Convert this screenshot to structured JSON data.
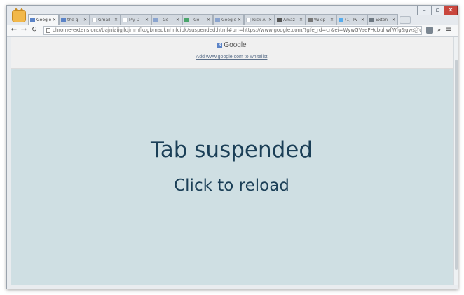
{
  "browser": {
    "tabs": [
      {
        "label": "Google",
        "favicon": "google-favicon",
        "color": "#5b83c7",
        "active": true
      },
      {
        "label": "the g",
        "favicon": "google-favicon",
        "color": "#5b83c7",
        "active": false
      },
      {
        "label": "Gmail",
        "favicon": "page-favicon",
        "color": "#bfc5cc",
        "active": false
      },
      {
        "label": "My D",
        "favicon": "page-favicon",
        "color": "#bfc5cc",
        "active": false
      },
      {
        "label": "- Go",
        "favicon": "docs-favicon",
        "color": "#8aa4cf",
        "active": false
      },
      {
        "label": "- Go",
        "favicon": "sheets-favicon",
        "color": "#4aa56b",
        "active": false
      },
      {
        "label": "Google",
        "favicon": "image-favicon",
        "color": "#8aa4cf",
        "active": false
      },
      {
        "label": "Rick A",
        "favicon": "page-favicon",
        "color": "#bfc5cc",
        "active": false
      },
      {
        "label": "Amaz",
        "favicon": "amazon-favicon",
        "color": "#555555",
        "active": false
      },
      {
        "label": "Wikip",
        "favicon": "wikipedia-favicon",
        "color": "#777777",
        "active": false
      },
      {
        "label": "(1) Tw",
        "favicon": "twitter-favicon",
        "color": "#55acee",
        "active": false
      },
      {
        "label": "Exten",
        "favicon": "puzzle-favicon",
        "color": "#6d7780",
        "active": false
      }
    ],
    "address": "chrome-extension://bajniaijgjldjmmfkcgbmaoknhnlcipk/suspended.html#uri=https://www.google.com/?gfe_rd=cr&ei=WywGVaePHcbulIwfWfg&gws_rd=ssl"
  },
  "page": {
    "title": "Google",
    "whitelist_link": "Add www.google.com to whitelist",
    "main_text": "Tab suspended",
    "sub_text": "Click to reload",
    "background_color": "#cfdfe3",
    "text_color": "#1b3f57"
  }
}
